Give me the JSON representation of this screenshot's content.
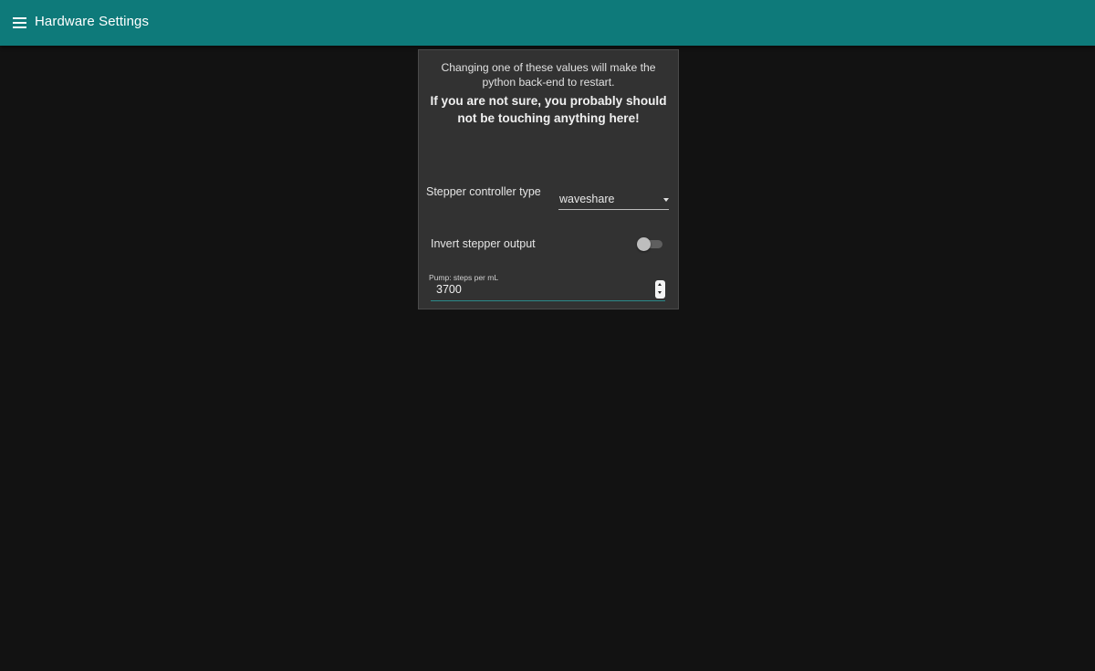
{
  "app_bar": {
    "title": "Hardware Settings",
    "menu_icon": "hamburger-menu-icon",
    "background_color": "#0e7a7a"
  },
  "panel": {
    "warning_text": "Changing one of these values will make the python back-end to restart.",
    "warning_strong": "If you are not sure, you probably should not be touching anything here!",
    "stepper_controller": {
      "label": "Stepper controller type",
      "selected_value": "waveshare",
      "dropdown_icon": "arrow-drop-down-icon"
    },
    "invert_stepper": {
      "label": "Invert stepper output",
      "checked": false
    },
    "pump_steps": {
      "label": "Pump: steps per mL",
      "value": "3700",
      "spinner_icon": "number-spinner-icon"
    }
  },
  "colors": {
    "page_background": "#121212",
    "panel_background": "#323232",
    "accent": "#0e7a7a"
  }
}
